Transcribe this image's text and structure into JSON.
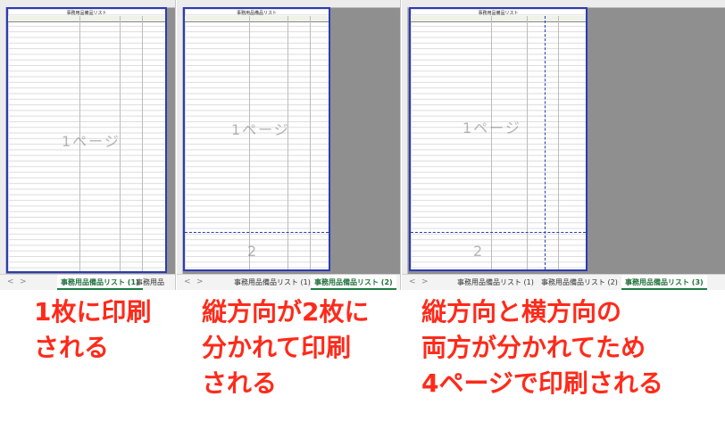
{
  "panels": [
    {
      "page_label": "1ページ",
      "tabs": [
        "事務用品備品リスト (1)",
        "事務用品"
      ],
      "active_tab": 0
    },
    {
      "page_label": "1ページ",
      "page2_label": "2",
      "tabs": [
        "事務用品備品リスト (1)",
        "事務用品備品リスト (2)"
      ],
      "active_tab": 1
    },
    {
      "page_label": "1ページ",
      "page2_label": "2",
      "tabs": [
        "事務用品備品リスト (1)",
        "事務用品備品リスト (2)",
        "事務用品備品リスト (3)"
      ],
      "active_tab": 2
    }
  ],
  "sheet_title": "事務用品備品リスト",
  "nav": {
    "prev": "<",
    "next": ">"
  },
  "captions": [
    {
      "lines": [
        "1枚に印刷",
        "される"
      ]
    },
    {
      "lines": [
        "縦方向が2枚に",
        "分かれて印刷",
        "される"
      ]
    },
    {
      "lines": [
        "縦方向と横方向の",
        "両方が分かれてため",
        "4ページで印刷される"
      ]
    }
  ],
  "colors": {
    "caption": "#ff2a1a",
    "page_border": "#2d3ab8",
    "active_tab": "#1f6f3a"
  }
}
